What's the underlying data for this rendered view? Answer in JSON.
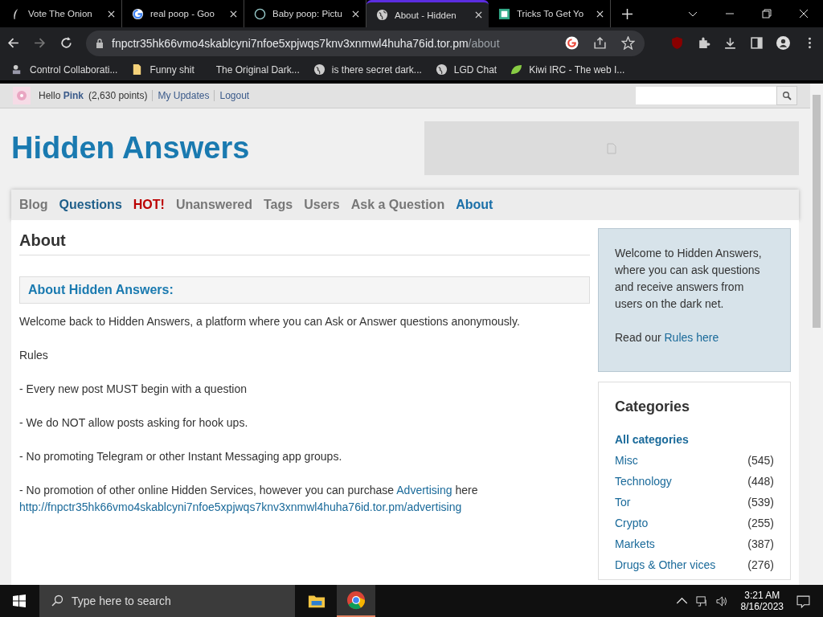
{
  "browser": {
    "tabs": [
      {
        "title": "Vote The Onion",
        "selected": false
      },
      {
        "title": "real poop - Goo",
        "selected": false
      },
      {
        "title": "Baby poop: Pictu",
        "selected": false
      },
      {
        "title": "About - Hidden",
        "selected": true
      },
      {
        "title": "Tricks To Get Yo",
        "selected": false
      }
    ],
    "address": {
      "host": "fnpctr35hk66vmo4skablcyni7nfoe5xpjwqs7knv3xnmwl4huha76id.tor.pm",
      "path": "/about"
    },
    "bookmarks": [
      {
        "title": "Control Collaborati..."
      },
      {
        "title": "Funny shit"
      },
      {
        "title": "The Original Dark..."
      },
      {
        "title": "is there secret dark..."
      },
      {
        "title": "LGD Chat"
      },
      {
        "title": "Kiwi IRC - The web I..."
      }
    ]
  },
  "page": {
    "user_bar": {
      "greeting": "Hello",
      "user": "Pink",
      "points": "(2,630 points)",
      "links": [
        "My Updates",
        "Logout"
      ]
    },
    "site_title": "Hidden Answers",
    "nav": [
      {
        "label": "Blog",
        "kind": "normal",
        "selected": false,
        "hovered": false
      },
      {
        "label": "Questions",
        "kind": "normal",
        "selected": false,
        "hovered": true
      },
      {
        "label": "HOT!",
        "kind": "hot",
        "selected": false,
        "hovered": false
      },
      {
        "label": "Unanswered",
        "kind": "normal",
        "selected": false,
        "hovered": false
      },
      {
        "label": "Tags",
        "kind": "normal",
        "selected": false,
        "hovered": false
      },
      {
        "label": "Users",
        "kind": "normal",
        "selected": false,
        "hovered": false
      },
      {
        "label": "Ask a Question",
        "kind": "normal",
        "selected": false,
        "hovered": false
      },
      {
        "label": "About",
        "kind": "normal",
        "selected": true,
        "hovered": false
      }
    ],
    "heading": "About",
    "box_title": "About Hidden Answers:",
    "body": [
      {
        "kind": "text",
        "text": "Welcome back to Hidden Answers, a platform where you can Ask or Answer questions anonymously."
      },
      {
        "kind": "text",
        "text": "Rules"
      },
      {
        "kind": "text",
        "text": "- Every new post MUST begin with a question"
      },
      {
        "kind": "text",
        "text": "- We do NOT allow posts asking for hook ups."
      },
      {
        "kind": "text",
        "text": "- No promoting Telegram or other Instant Messaging app groups."
      },
      {
        "kind": "ad",
        "before": "- No promotion of other online Hidden Services, however you can purchase",
        "link": "Advertising",
        "after": "here",
        "url": "http://fnpctr35hk66vmo4skablcyni7nfoe5xpjwqs7knv3xnmwl4huha76id.tor.pm/advertising"
      }
    ],
    "welcome": {
      "text": "Welcome to Hidden Answers, where you can ask questions and receive answers from users on the dark net.",
      "read": "Read our",
      "link": "Rules here"
    },
    "categories": {
      "title": "Categories",
      "all": "All categories",
      "items": [
        {
          "name": "Misc",
          "count": "(545)"
        },
        {
          "name": "Technology",
          "count": "(448)"
        },
        {
          "name": "Tor",
          "count": "(539)"
        },
        {
          "name": "Crypto",
          "count": "(255)"
        },
        {
          "name": "Markets",
          "count": "(387)"
        },
        {
          "name": "Drugs & Other vices",
          "count": "(276)"
        }
      ]
    }
  },
  "taskbar": {
    "search_placeholder": "Type here to search",
    "time": "3:21 AM",
    "date": "8/16/2023"
  }
}
